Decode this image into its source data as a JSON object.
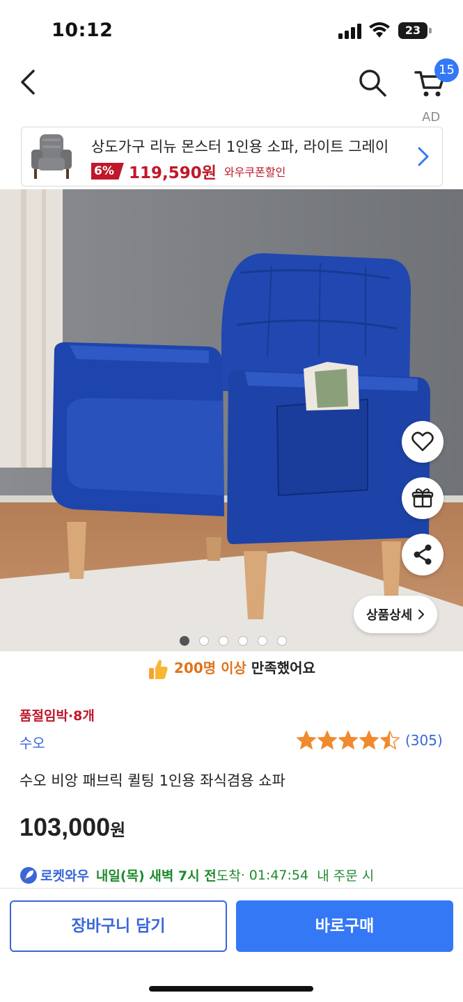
{
  "status_bar": {
    "time": "10:12",
    "battery": "23"
  },
  "nav": {
    "cart_badge": "15",
    "ad_label": "AD"
  },
  "ad_banner": {
    "title": "상도가구 리뉴 몬스터 1인용 소파, 라이트 그레이",
    "discount": "6%",
    "price": "119,590원",
    "coupon": "와우쿠폰할인"
  },
  "gallery": {
    "detail_button": "상품상세",
    "slide_count": 6,
    "active_slide": 1,
    "sofa_color": "#1f48b8"
  },
  "satisfaction": {
    "highlight": "200명 이상",
    "text": " 만족했어요"
  },
  "product": {
    "stock": "품절임박·8개",
    "brand": "수오",
    "rating": 4.5,
    "review_count": "(305)",
    "name": "수오 비앙 패브릭 퀼팅 1인용 좌식겸용 쇼파",
    "price": "103,000",
    "price_unit": "원"
  },
  "delivery": {
    "badge": "로켓와우",
    "arrival": "내일(목) 새벽 7시 전",
    "arrive_word": " 도착",
    "countdown": " · 01:47:54",
    "suffix": "  내 주문 시"
  },
  "bottom": {
    "cart_button": "장바구니 담기",
    "buy_button": "바로구매"
  },
  "colors": {
    "accent": "#3478f6",
    "sale_red": "#c0182a",
    "link_blue": "#3a66d9",
    "star": "#f08a2e",
    "delivery_green": "#1f8a2e"
  }
}
